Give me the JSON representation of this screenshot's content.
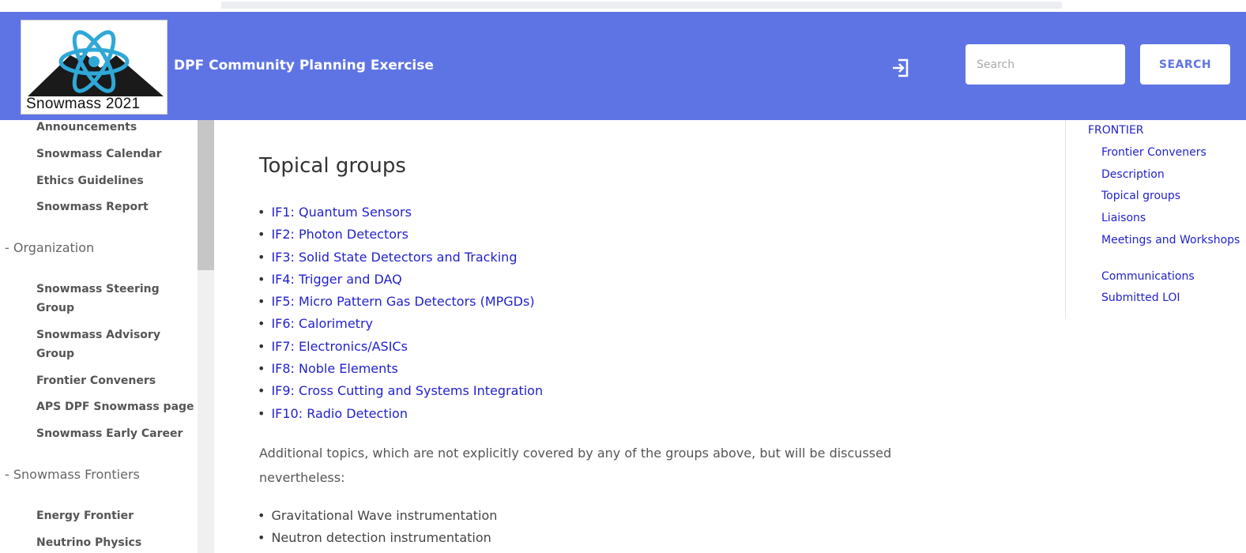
{
  "header": {
    "logo_text": "Snowmass 2021",
    "site_title": "DPF Community Planning Exercise",
    "search_placeholder": "Search",
    "search_button": "SEARCH",
    "login_icon": "login-icon"
  },
  "sidebar": {
    "items_top": [
      "Announcements",
      "Snowmass Calendar",
      "Ethics Guidelines",
      "Snowmass Report"
    ],
    "organization_label": "- Organization",
    "organization_items": [
      "Snowmass Steering Group",
      "Snowmass Advisory Group",
      "Frontier Conveners",
      "APS DPF Snowmass page",
      "Snowmass Early Career"
    ],
    "frontiers_label": "- Snowmass Frontiers",
    "frontier_items": [
      "Energy Frontier",
      "Neutrino Physics Frontier"
    ]
  },
  "main": {
    "title": "Topical groups",
    "groups": [
      "IF1: Quantum Sensors",
      "IF2: Photon Detectors",
      "IF3: Solid State Detectors and Tracking",
      "IF4: Trigger and DAQ",
      "IF5: Micro Pattern Gas Detectors (MPGDs)",
      "IF6: Calorimetry",
      "IF7: Electronics/ASICs",
      "IF8: Noble Elements",
      "IF9: Cross Cutting and Systems Integration",
      "IF10: Radio Detection"
    ],
    "additional_text": "Additional topics, which are not explicitly covered by any of the groups above, but will be discussed nevertheless:",
    "additional_topics": [
      "Gravitational Wave instrumentation",
      "Neutron detection instrumentation"
    ]
  },
  "toc": {
    "head": "FRONTIER",
    "items": [
      "Frontier Conveners",
      "Description",
      "Topical groups",
      "Liaisons",
      "Meetings and Workshops",
      "Communications",
      "Submitted LOI"
    ]
  },
  "colors": {
    "header_bg": "#5f74e4",
    "link": "#2222cc"
  }
}
